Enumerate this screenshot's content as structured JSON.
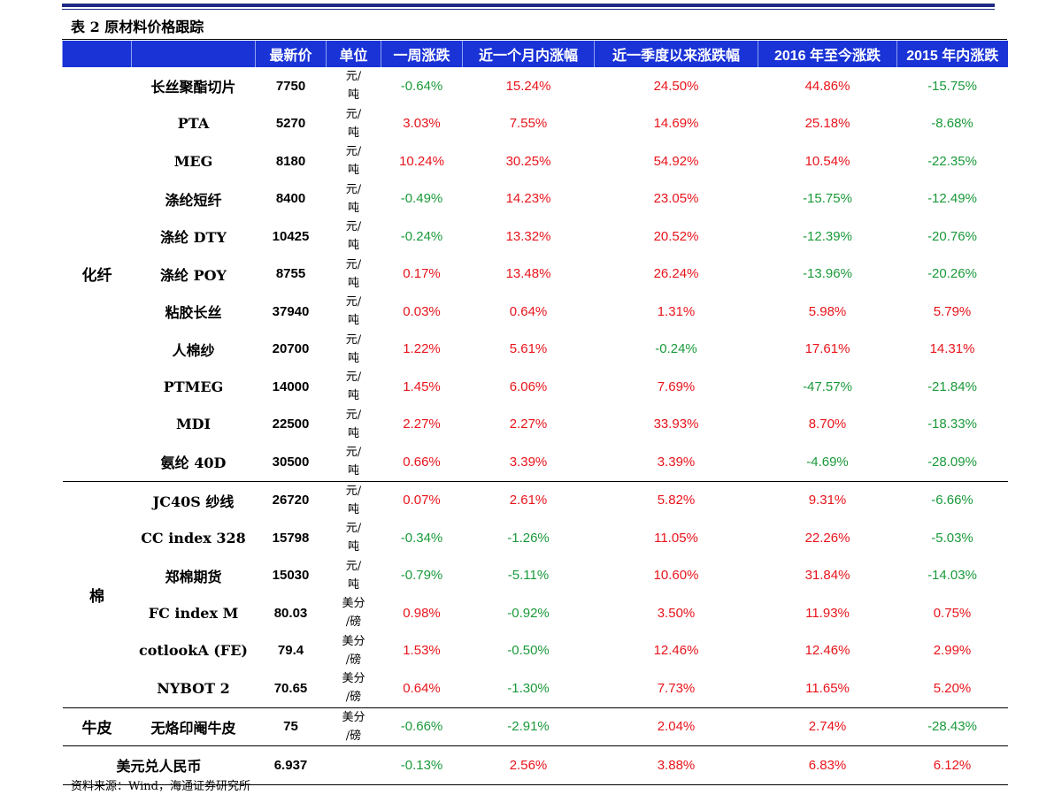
{
  "caption": "表 2 原材料价格跟踪",
  "headers": [
    "",
    "",
    "最新价",
    "单位",
    "一周涨跌",
    "近一个月内涨幅",
    "近一季度以来涨跌幅",
    "2016 年至今涨跌",
    "2015 年内涨跌"
  ],
  "groups": [
    {
      "name": "化纤",
      "rows": [
        {
          "name": "长丝聚酯切片",
          "price": "7750",
          "unit1": "元/",
          "unit2": "吨",
          "v": [
            "-0.64%",
            "15.24%",
            "24.50%",
            "44.86%",
            "-15.75%"
          ]
        },
        {
          "name": "PTA",
          "price": "5270",
          "unit1": "元/",
          "unit2": "吨",
          "v": [
            "3.03%",
            "7.55%",
            "14.69%",
            "25.18%",
            "-8.68%"
          ]
        },
        {
          "name": "MEG",
          "price": "8180",
          "unit1": "元/",
          "unit2": "吨",
          "v": [
            "10.24%",
            "30.25%",
            "54.92%",
            "10.54%",
            "-22.35%"
          ]
        },
        {
          "name": "涤纶短纤",
          "price": "8400",
          "unit1": "元/",
          "unit2": "吨",
          "v": [
            "-0.49%",
            "14.23%",
            "23.05%",
            "-15.75%",
            "-12.49%"
          ]
        },
        {
          "name": "涤纶 DTY",
          "price": "10425",
          "unit1": "元/",
          "unit2": "吨",
          "v": [
            "-0.24%",
            "13.32%",
            "20.52%",
            "-12.39%",
            "-20.76%"
          ]
        },
        {
          "name": "涤纶 POY",
          "price": "8755",
          "unit1": "元/",
          "unit2": "吨",
          "v": [
            "0.17%",
            "13.48%",
            "26.24%",
            "-13.96%",
            "-20.26%"
          ]
        },
        {
          "name": "粘胶长丝",
          "price": "37940",
          "unit1": "元/",
          "unit2": "吨",
          "v": [
            "0.03%",
            "0.64%",
            "1.31%",
            "5.98%",
            "5.79%"
          ]
        },
        {
          "name": "人棉纱",
          "price": "20700",
          "unit1": "元/",
          "unit2": "吨",
          "v": [
            "1.22%",
            "5.61%",
            "-0.24%",
            "17.61%",
            "14.31%"
          ]
        },
        {
          "name": "PTMEG",
          "price": "14000",
          "unit1": "元/",
          "unit2": "吨",
          "v": [
            "1.45%",
            "6.06%",
            "7.69%",
            "-47.57%",
            "-21.84%"
          ]
        },
        {
          "name": "MDI",
          "price": "22500",
          "unit1": "元/",
          "unit2": "吨",
          "v": [
            "2.27%",
            "2.27%",
            "33.93%",
            "8.70%",
            "-18.33%"
          ]
        },
        {
          "name": "氨纶 40D",
          "price": "30500",
          "unit1": "元/",
          "unit2": "吨",
          "v": [
            "0.66%",
            "3.39%",
            "3.39%",
            "-4.69%",
            "-28.09%"
          ]
        }
      ]
    },
    {
      "name": "棉",
      "rows": [
        {
          "name": "JC40S 纱线",
          "price": "26720",
          "unit1": "元/",
          "unit2": "吨",
          "v": [
            "0.07%",
            "2.61%",
            "5.82%",
            "9.31%",
            "-6.66%"
          ]
        },
        {
          "name": "CC index 328",
          "price": "15798",
          "unit1": "元/",
          "unit2": "吨",
          "v": [
            "-0.34%",
            "-1.26%",
            "11.05%",
            "22.26%",
            "-5.03%"
          ]
        },
        {
          "name": "郑棉期货",
          "price": "15030",
          "unit1": "元/",
          "unit2": "吨",
          "v": [
            "-0.79%",
            "-5.11%",
            "10.60%",
            "31.84%",
            "-14.03%"
          ]
        },
        {
          "name": "FC index M",
          "price": "80.03",
          "unit1": "美分",
          "unit2": "/磅",
          "v": [
            "0.98%",
            "-0.92%",
            "3.50%",
            "11.93%",
            "0.75%"
          ]
        },
        {
          "name": "cotlookA (FE)",
          "price": "79.4",
          "unit1": "美分",
          "unit2": "/磅",
          "v": [
            "1.53%",
            "-0.50%",
            "12.46%",
            "12.46%",
            "2.99%"
          ]
        },
        {
          "name": "NYBOT 2",
          "price": "70.65",
          "unit1": "美分",
          "unit2": "/磅",
          "v": [
            "0.64%",
            "-1.30%",
            "7.73%",
            "11.65%",
            "5.20%"
          ]
        }
      ]
    },
    {
      "name": "牛皮",
      "rows": [
        {
          "name": "无烙印阉牛皮",
          "price": "75",
          "unit1": "美分",
          "unit2": "/磅",
          "v": [
            "-0.66%",
            "-2.91%",
            "2.04%",
            "2.74%",
            "-28.43%"
          ]
        }
      ]
    }
  ],
  "fx_row": {
    "name": "美元兑人民币",
    "price": "6.937",
    "v": [
      "-0.13%",
      "2.56%",
      "3.88%",
      "6.83%",
      "6.12%"
    ]
  },
  "colors": {
    "header_bg": "#1a33d6",
    "positive": "#e8141b",
    "negative": "#1a9a3a",
    "rule": "#1f2a86"
  },
  "footnote": "资料来源：Wind，海通证券研究所"
}
